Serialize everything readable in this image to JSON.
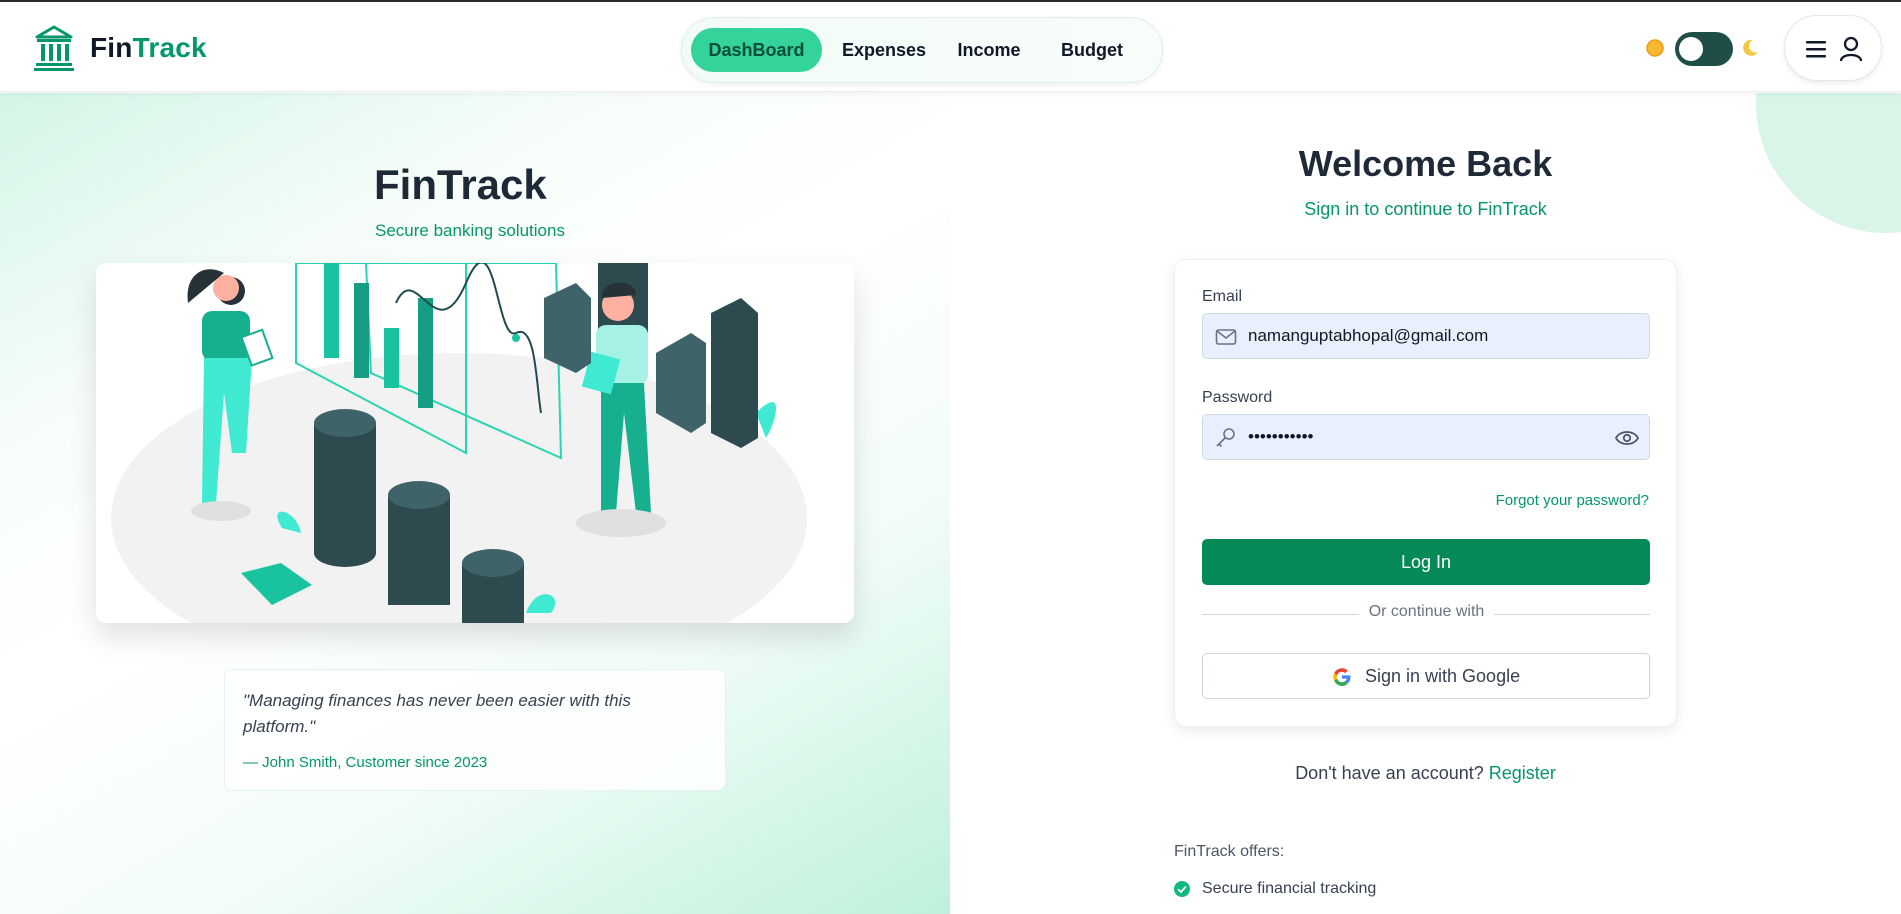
{
  "app": {
    "name_part1": "Fin",
    "name_part2": "Track"
  },
  "nav": {
    "items": [
      {
        "label": "DashBoard",
        "active": true
      },
      {
        "label": "Expenses",
        "active": false
      },
      {
        "label": "Income",
        "active": false
      },
      {
        "label": "Budget",
        "active": false
      }
    ]
  },
  "theme": {
    "mode": "light",
    "sun_icon": "sun-icon",
    "moon_icon": "moon-icon"
  },
  "hero": {
    "title": "FinTrack",
    "subtitle": "Secure banking solutions",
    "quote": "\"Managing finances has never been easier with this platform.\"",
    "author": "— John Smith, Customer since 2023"
  },
  "login": {
    "title": "Welcome Back",
    "subtitle": "Sign in to continue to FinTrack",
    "email_label": "Email",
    "email_value": "namanguptabhopal@gmail.com",
    "password_label": "Password",
    "password_value": "•••••••••••",
    "forgot": "Forgot your password?",
    "login_button": "Log In",
    "divider": "Or continue with",
    "google_button": "Sign in with Google",
    "no_account": "Don't have an account?",
    "register": "Register"
  },
  "offers": {
    "title": "FinTrack offers:",
    "items": [
      "Secure financial tracking"
    ]
  },
  "colors": {
    "brand_green": "#059669",
    "button_green": "#058a57",
    "active_nav": "#34d399",
    "toggle": "#1f4e46"
  }
}
